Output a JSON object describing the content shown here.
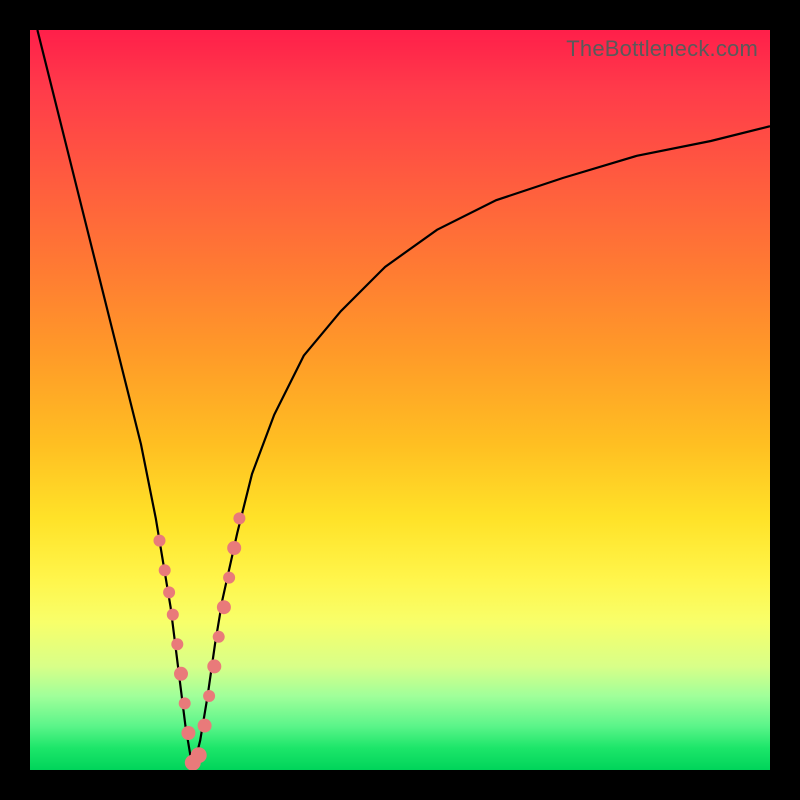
{
  "watermark": "TheBottleneck.com",
  "colors": {
    "gradient_top": "#ff1f4a",
    "gradient_mid1": "#ff9b28",
    "gradient_mid2": "#fff54a",
    "gradient_bottom": "#00d45a",
    "curve": "#000000",
    "marker": "#e97a7a",
    "frame": "#000000"
  },
  "chart_data": {
    "type": "line",
    "title": "",
    "xlabel": "",
    "ylabel": "",
    "xlim": [
      0,
      100
    ],
    "ylim": [
      0,
      100
    ],
    "note": "V-shaped bottleneck curve; y is approximate % (0 at minimum, 100 at top). Minimum around x≈22.",
    "series": [
      {
        "name": "bottleneck-curve",
        "x": [
          1,
          3,
          5,
          7,
          9,
          11,
          13,
          15,
          17,
          18,
          19,
          20,
          21,
          22,
          23,
          24,
          25,
          26,
          28,
          30,
          33,
          37,
          42,
          48,
          55,
          63,
          72,
          82,
          92,
          100
        ],
        "y": [
          100,
          92,
          84,
          76,
          68,
          60,
          52,
          44,
          34,
          28,
          22,
          14,
          6,
          0,
          4,
          10,
          17,
          23,
          32,
          40,
          48,
          56,
          62,
          68,
          73,
          77,
          80,
          83,
          85,
          87
        ]
      }
    ],
    "markers": {
      "name": "highlight-points",
      "x": [
        17.5,
        18.2,
        18.8,
        19.3,
        19.9,
        20.4,
        20.9,
        21.4,
        22.0,
        22.8,
        23.6,
        24.2,
        24.9,
        25.5,
        26.2,
        26.9,
        27.6,
        28.3
      ],
      "y": [
        31,
        27,
        24,
        21,
        17,
        13,
        9,
        5,
        1,
        2,
        6,
        10,
        14,
        18,
        22,
        26,
        30,
        34
      ],
      "r": [
        6,
        6,
        6,
        6,
        6,
        7,
        6,
        7,
        8,
        8,
        7,
        6,
        7,
        6,
        7,
        6,
        7,
        6
      ]
    }
  }
}
